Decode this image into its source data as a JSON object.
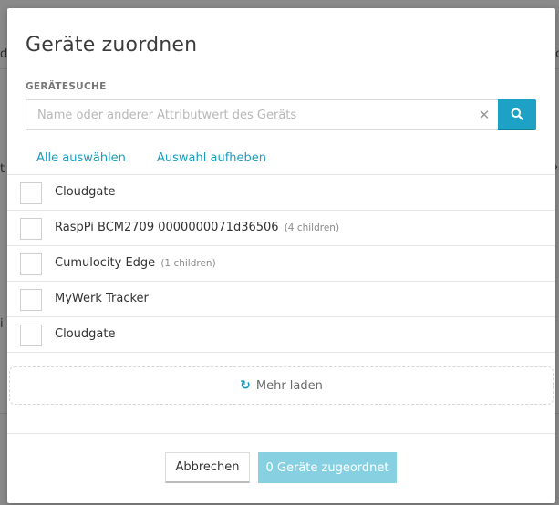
{
  "modal": {
    "title": "Geräte zuordnen",
    "search": {
      "label": "GERÄTESUCHE",
      "placeholder": "Name oder anderer Attributwert des Geräts",
      "value": ""
    },
    "select_all": "Alle auswählen",
    "deselect_all": "Auswahl aufheben",
    "devices": [
      {
        "name": "Cloudgate",
        "children": "",
        "checked": false
      },
      {
        "name": "RaspPi BCM2709 0000000071d36506",
        "children": "(4 children)",
        "checked": false
      },
      {
        "name": "Cumulocity Edge",
        "children": "(1 children)",
        "checked": false
      },
      {
        "name": "MyWerk Tracker",
        "children": "",
        "checked": false
      },
      {
        "name": "Cloudgate",
        "children": "",
        "checked": false
      }
    ],
    "load_more": "Mehr laden",
    "cancel_label": "Abbrechen",
    "assign_label": "0 Geräte zugeordnet"
  },
  "colors": {
    "accent": "#1da1c4",
    "accent_disabled": "#86d0e2",
    "backdrop": "#8a8a8a"
  }
}
